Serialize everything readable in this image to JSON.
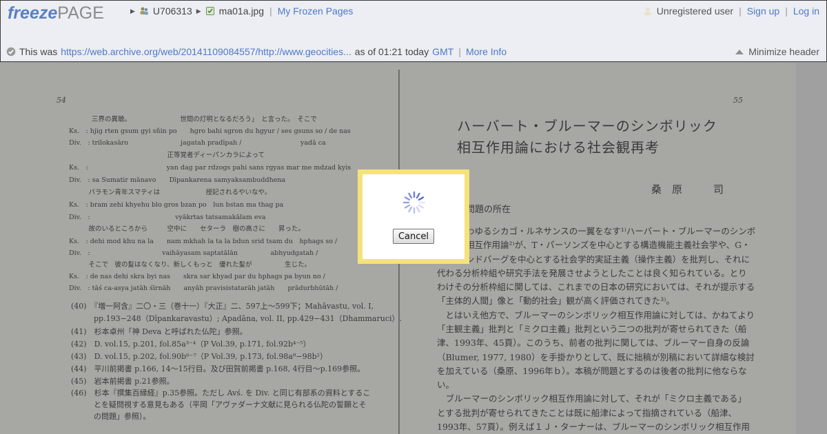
{
  "header": {
    "logo": {
      "part1": "freeze",
      "part2": "PAGE"
    },
    "breadcrumbs": [
      {
        "label": "U706313",
        "icon": "users-icon"
      },
      {
        "label": "ma01a.jpg",
        "icon": "image-file-icon"
      }
    ],
    "my_frozen_pages": "My Frozen Pages",
    "user": {
      "status": "Unregistered user",
      "sign_up": "Sign up",
      "log_in": "Log in"
    },
    "info": {
      "prefix": "This was",
      "url": "https://web.archive.org/web/20141109084557/http://www.geocities...",
      "as_of": "as of 01:21 today",
      "tz": "GMT",
      "more_info": "More Info"
    },
    "minimize": "Minimize header"
  },
  "scan": {
    "left_page_number": "54",
    "right_page_number": "55",
    "right_title_1": "ハーバート・ブルーマーのシンボリック",
    "right_title_2": "相互作用論における社会観再考",
    "author": "桑　原　　　司",
    "section_heading": "問題の所在",
    "left_lines": [
      "三界の異聴。　　　　　　　　世間の灯明となるだろう」　と言った。　そこで",
      "Ks.　: hjig rten gsum gyi sñin po　　hgro bahi sgron du hgyur / ses gsuns so / de nas",
      "Div.　: trilokasāro　　　　　　　　jagatah pradīpah /　　　　　　　　　yadā ca",
      "　　　　　　　　　　　　　　　正等覚者ディーパンカラによって",
      "Ks.　:　　　　　　　　　　　　yan dag par rdzogs pahi sans rgyas mar me mdzad kyis",
      "Div.　: sa Sumatir mānavo　　Dīpankarena samyaksambuddhena",
      "　　　バラモン青年スマティは　　　　　　　授記されるやいなや。",
      "Ks.　: bram zehi khyehu blo gros bzan po　lun bstan ma thag pa",
      "Div.　:　　　　　　　　　　　　　vyākrtas tatsamakālam eva",
      "　　　故のいるところから　　　空中に　　セターラ　樹の高さに　　昇った。",
      "Ks.　: dehi mod khu na la　　nam mkhah la ta la bdun srid tsam du　hphags so /",
      "Div.　:　　　　　　　　　　　vaihāyasam saptatālān　　　　　abhyudgatah /",
      "　　　そこで　彼の髪はなくなり、新しくもっと　優れた髪が　　　　　生じた。",
      "Ks.　: de nas dehi skra byi nas　　skra sar khyad par du hphags pa byun no /",
      "Div.　: tāś ca-asya jatāh śīrnāh　　anyāh pravisistatarāh jatāh　　prādurbhūtāh /"
    ],
    "notes": [
      "(40)　『増一阿含』二〇・三（巻十一）『大正』二、597上〜599下；Mahāvastu, vol. I,",
      "　　　pp.193−248（Dīpankaravastu）; Apadāna, vol. II, pp.429−431（Dhammaruci）.",
      "(41)　杉本卓州「神 Deva と呼ばれた仏陀」参照。",
      "(42)　D. vol.15, p.201, fol.85a³⁻⁴（P Vol.39, p.171, fol.92b⁴⁻⁵）",
      "(43)　D. vol.15, p.202, fol.90b⁶⁻⁷（P Vol.39, p.173, fol.98a⁸−98b²）",
      "(44)　平川前掲書 p.166, 14〜15行目。及び田賀前掲書 p.168, 4行目〜p.169参照。",
      "(45)　岩本前掲書 p.21参照。",
      "(46)　杉本『撰集百縁経』p.35参照。ただし Avś. を Div. と同じ有部系の資料とするこ",
      "　　　とを疑問視する意見もある（平岡「アヴァダーナ文献に見られる仏陀の誓願とそ",
      "　　　の問題」参照）。"
    ],
    "right_lines": [
      "わゆるシカゴ・ルネサンスの一翼をなす¹⁾ハーバート・ブルーマーのシンボ",
      "相互作用論²⁾が、T・パーソンズを中心とする構造機能主義社会学や、G・",
      "ンドバーグを中心とする社会学的実証主義（操作主義）を批判し、それに",
      "代わる分析枠組や研究手法を発展させようとしたことは良く知られている。とり",
      "わけその分析枠組に関しては、これまでの日本の研究においては、それが提示する",
      "「主体的人間」像と「動的社会」観が高く評価されてきた³⁾。",
      "　とはいえ他方で、ブルーマーのシンボリック相互作用論に対しては、かねてより",
      "「主観主義」批判と「ミクロ主義」批判という二つの批判が寄せられてきた（船",
      "津、1993年、45頁）。このうち、前者の批判に関しては、ブルーマー自身の反論",
      "（Blumer, 1977, 1980）を手掛かりとして、既に拙稿が別稿において詳細な検討",
      "を加えている（桑原、1996年ｂ）。本稿が問題とするのは後者の批判に他ならな",
      "い。",
      "　ブルーマーのシンボリック相互作用論に対して、それが「ミクロ主義である」",
      "とする批判が寄せられてきたことは既に船津によって指摘されている（船津、",
      "1993年、57頁）。例えば１Ｊ・ターナーは、ブルーマーのシンボリック相互作用"
    ]
  },
  "dialog": {
    "cancel_label": "Cancel",
    "spinner_icon": "loading-spinner-icon",
    "border_color": "#f5e27a"
  }
}
